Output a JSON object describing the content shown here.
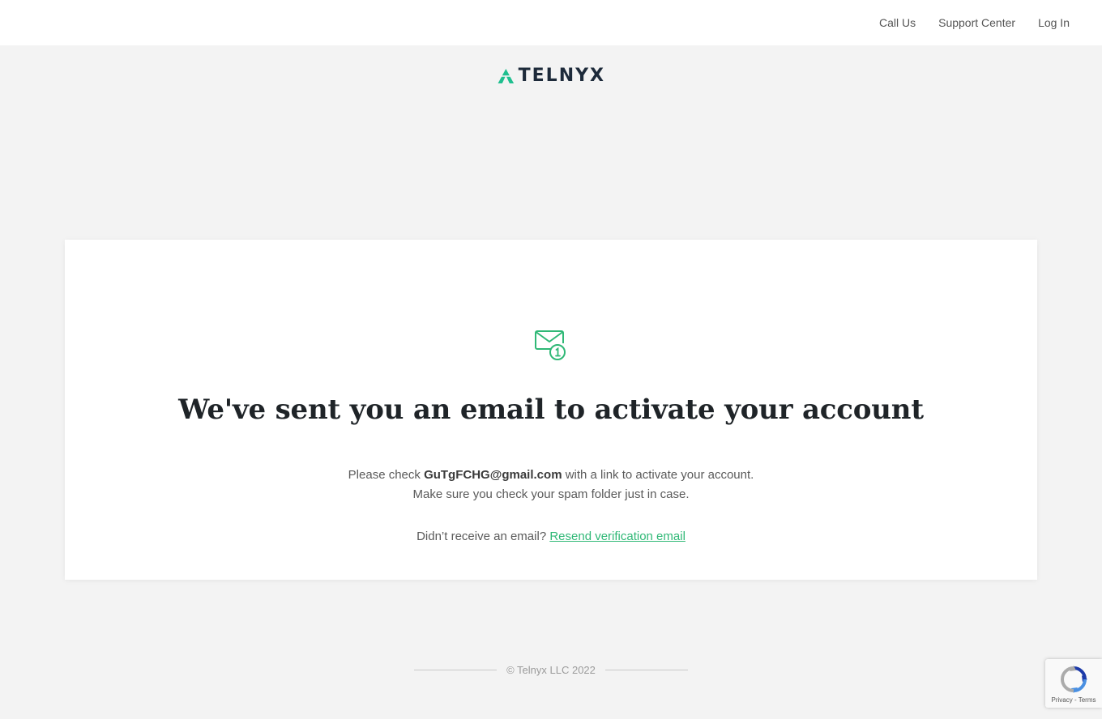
{
  "topnav": {
    "items": [
      {
        "label": "Call Us"
      },
      {
        "label": "Support Center"
      },
      {
        "label": "Log In"
      }
    ]
  },
  "brand": {
    "name": "TELNYX",
    "accent_color": "#1fbf8f",
    "text_color": "#1d2a3a"
  },
  "card": {
    "icon": "mail-notification-icon",
    "headline": "We've sent you an email to activate your account",
    "line1_prefix": "Please check ",
    "email": "GuTgFCHG@gmail.com",
    "line1_suffix": " with a link to activate your account.",
    "line2": "Make sure you check your spam folder just in case.",
    "resend_prompt": "Didn’t receive an email? ",
    "resend_link": "Resend verification email",
    "link_color": "#2fb876"
  },
  "footer": {
    "copyright": "© Telnyx LLC 2022"
  },
  "recaptcha": {
    "terms": "Privacy - Terms",
    "icon": "recaptcha-icon"
  }
}
